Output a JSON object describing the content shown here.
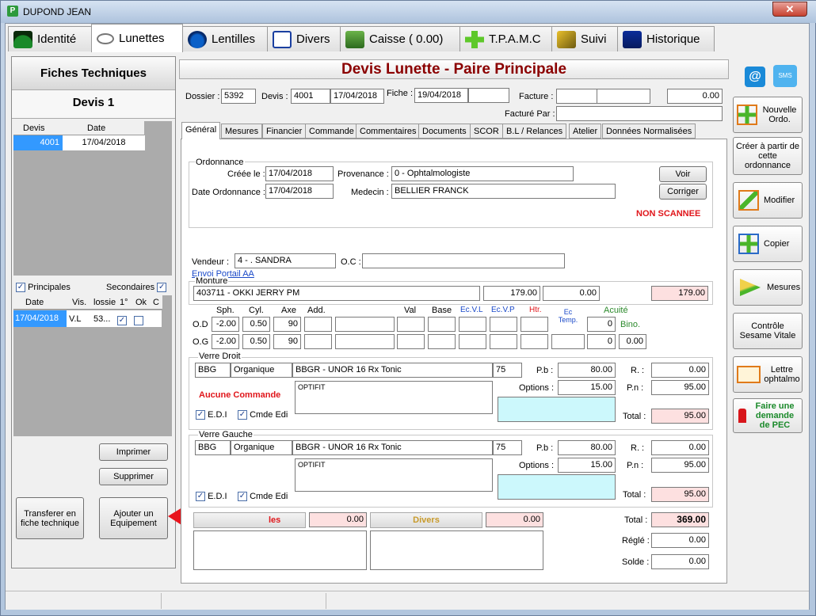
{
  "window": {
    "title": "DUPOND JEAN",
    "close": "✕"
  },
  "main_tabs": [
    "Identité",
    "Lunettes",
    "Lentilles",
    "Divers",
    "Caisse ( 0.00)",
    "T.P.A.M.C",
    "Suivi",
    "Historique"
  ],
  "left": {
    "header": "Fiches Techniques",
    "subheader": "Devis 1",
    "devis_cols": [
      "Devis",
      "Date"
    ],
    "devis_row": [
      "4001",
      "17/04/2018"
    ],
    "principales": "Principales",
    "secondaires": "Secondaires",
    "fiche_cols": [
      "Date",
      "Vis.",
      "lossie",
      "1°",
      "Ok",
      "C"
    ],
    "fiche_row": [
      "17/04/2018",
      "V.L",
      "53..."
    ],
    "imprimer": "Imprimer",
    "supprimer": "Supprimer",
    "transferer": "Transferer en fiche technique",
    "ajouter": "Ajouter un Equipement"
  },
  "form": {
    "title": "Devis Lunette - Paire Principale",
    "dossier_lbl": "Dossier :",
    "dossier": "5392",
    "devis_lbl": "Devis :",
    "devis": "4001",
    "devis_date": "17/04/2018",
    "fiche_lbl": "Fiche :",
    "fiche": "19/04/2018",
    "facture_lbl": "Facture :",
    "facture_amt": "0.00",
    "facture_par_lbl": "Facturé Par :",
    "tabs": [
      "Général",
      "Mesures",
      "Financier",
      "Commande",
      "Commentaires",
      "Documents",
      "SCOR",
      "B.L / Relances",
      "Atelier",
      "Données Normalisées"
    ],
    "ordonnance": "Ordonnance",
    "creee_lbl": "Créée le :",
    "creee": "17/04/2018",
    "provenance_lbl": "Provenance :",
    "provenance": "0 - Ophtalmologiste",
    "date_ord_lbl": "Date Ordonnance :",
    "date_ord": "17/04/2018",
    "medecin_lbl": "Medecin :",
    "medecin": "BELLIER FRANCK",
    "voir": "Voir",
    "corriger": "Corriger",
    "non_scannee": "NON SCANNEE",
    "vendeur_lbl": "Vendeur :",
    "vendeur": "4 - . SANDRA",
    "oc_lbl": "O.C :",
    "envoi_portail": "Envoi Portail AA",
    "monture_lbl": "Monture",
    "monture": "403711 - OKKI JERRY PM",
    "monture_prix": "179.00",
    "monture_rem": "0.00",
    "monture_total": "179.00",
    "rx_headers": [
      "Sph.",
      "Cyl.",
      "Axe",
      "Add.",
      "Val",
      "Base",
      "Ec.V.L",
      "Ec.V.P",
      "Htr.",
      "Ec Temp.",
      "Acuité"
    ],
    "od_lbl": "O.D",
    "od": [
      "-2.00",
      "0.50",
      "90"
    ],
    "od_acuite": "0",
    "bino": "Bino.",
    "og_lbl": "O.G",
    "og": [
      "-2.00",
      "0.50",
      "90"
    ],
    "og_acuite": "0",
    "bino_val": "0.00",
    "vd_lbl": "Verre Droit",
    "vd": [
      "BBG",
      "Organique",
      "BBGR - UNOR 16 Rx Tonic",
      "75"
    ],
    "vd_desc": "OPTIFIT",
    "aucune": "Aucune Commande",
    "edi": "E.D.I",
    "cmde_edi": "Cmde Edi",
    "pb_lbl": "P.b :",
    "vd_pb": "80.00",
    "options_lbl": "Options :",
    "vd_opt": "15.00",
    "r_lbl": "R. :",
    "vd_r": "0.00",
    "pn_lbl": "P.n :",
    "vd_pn": "95.00",
    "total_lbl": "Total :",
    "vd_total": "95.00",
    "vg_lbl": "Verre Gauche",
    "vg": [
      "BBG",
      "Organique",
      "BBGR - UNOR 16 Rx Tonic",
      "75"
    ],
    "vg_desc": "OPTIFIT",
    "vg_pb": "80.00",
    "vg_opt": "15.00",
    "vg_r": "0.00",
    "vg_pn": "95.00",
    "vg_total": "95.00",
    "les_lbl": "les",
    "les_amt": "0.00",
    "divers_lbl": "Divers",
    "divers_amt": "0.00",
    "grand_total": "369.00",
    "regle_lbl": "Réglé :",
    "regle": "0.00",
    "solde_lbl": "Solde :",
    "solde": "0.00"
  },
  "sidebar": {
    "nouvelle": "Nouvelle Ordo.",
    "creer": "Créer à partir de cette ordonnance",
    "modifier": "Modifier",
    "copier": "Copier",
    "mesures": "Mesures",
    "controle": "Contrôle Sesame Vitale",
    "lettre": "Lettre ophtalmo",
    "faire": "Faire une demande de PEC",
    "sms": "SMS",
    "at": "@"
  },
  "colors": {
    "accent": "#8b0000",
    "arrow": "#e8141c",
    "blue": "#1a49c8"
  }
}
